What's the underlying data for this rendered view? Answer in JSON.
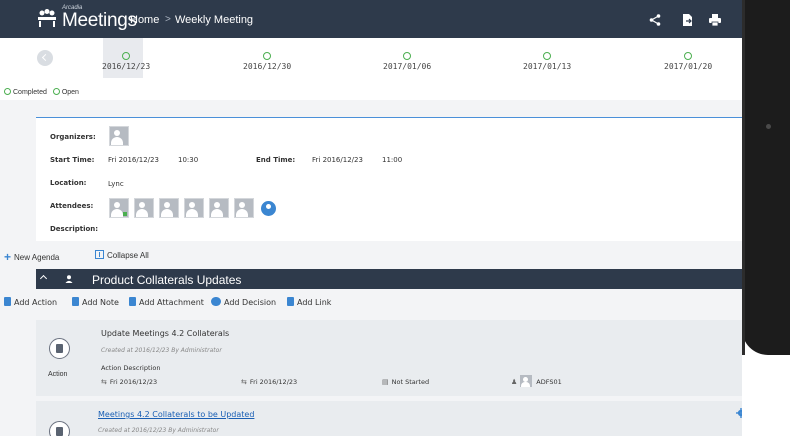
{
  "header": {
    "logo_brand": "Arcadia",
    "logo_text": "Meetings",
    "breadcrumb_home": "Home",
    "breadcrumb_separator": ">",
    "breadcrumb_current": "Weekly Meeting",
    "icons": [
      "share-icon",
      "export-icon",
      "print-icon"
    ],
    "background": "#2e3a4b"
  },
  "timeline": {
    "dates": [
      "2016/12/23",
      "2016/12/30",
      "2017/01/06",
      "2017/01/13",
      "2017/01/20"
    ],
    "legend_completed": "Completed",
    "legend_open": "Open",
    "status_color": "#4caf50"
  },
  "details": {
    "organizers_label": "Organizers:",
    "start_time_label": "Start Time:",
    "start_date": "Fri 2016/12/23",
    "start_time": "10:30",
    "end_time_label": "End Time:",
    "end_date": "Fri 2016/12/23",
    "end_time": "11:00",
    "location_label": "Location:",
    "location": "Lync",
    "attendees_label": "Attendees:",
    "description_label": "Description:",
    "accent": "#4a90d9"
  },
  "agenda_actions": {
    "new_agenda": "New Agenda",
    "collapse_all": "Collapse All"
  },
  "agenda": {
    "title": "Product Collaterals Updates",
    "toolbar": {
      "add_action": "Add Action",
      "add_note": "Add Note",
      "add_attachment": "Add Attachment",
      "add_decision": "Add Decision",
      "add_link": "Add Link"
    },
    "items": [
      {
        "kind": "Action",
        "title": "Update Meetings 4.2 Collaterals",
        "created": "Created at  2016/12/23  By  Administrator",
        "description_label": "Action Description",
        "start_date": "Fri 2016/12/23",
        "due_date": "Fri 2016/12/23",
        "status": "Not Started",
        "assignee": "ADFS01"
      },
      {
        "title": "Meetings 4.2 Collaterals to be Updated",
        "created": "Created at  2016/12/23  By  Administrator"
      }
    ]
  }
}
